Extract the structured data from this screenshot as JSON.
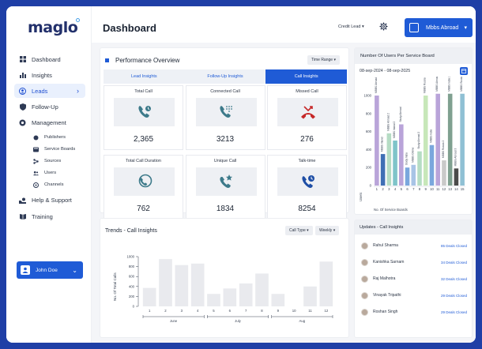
{
  "app": {
    "logo_text": "maglo"
  },
  "sidebar": {
    "items": [
      {
        "label": "Dashboard",
        "icon": "grid-icon"
      },
      {
        "label": "Insights",
        "icon": "bar-chart-icon"
      },
      {
        "label": "Leads",
        "icon": "user-circle-icon",
        "active": true
      },
      {
        "label": "Follow-Up",
        "icon": "shield-icon"
      },
      {
        "label": "Management",
        "icon": "globe-icon"
      }
    ],
    "sub_items": [
      {
        "label": "Publishers",
        "icon": "globe-small-icon"
      },
      {
        "label": "Service Boards",
        "icon": "board-icon"
      },
      {
        "label": "Sources",
        "icon": "source-icon"
      },
      {
        "label": "Users",
        "icon": "users-icon"
      },
      {
        "label": "Channels",
        "icon": "channels-icon"
      }
    ],
    "bottom_items": [
      {
        "label": "Help & Support",
        "icon": "help-icon"
      },
      {
        "label": "Training",
        "icon": "book-icon"
      }
    ],
    "user": {
      "name": "John Doe"
    }
  },
  "header": {
    "title": "Dashboard",
    "credit_label": "Credit Lead",
    "account_button": "Mbbs Abroad"
  },
  "performance": {
    "title": "Performance Overview",
    "time_range_label": "Time Range",
    "tabs": [
      "Lead Insights",
      "Follow-Up Insights",
      "Call Insights"
    ],
    "active_tab": 2,
    "cards": [
      {
        "label": "Total Call",
        "value": "2,365",
        "icon": "phone-clock-icon"
      },
      {
        "label": "Connected Call",
        "value": "3213",
        "icon": "phone-dial-icon"
      },
      {
        "label": "Missed Call",
        "value": "276",
        "icon": "missed-call-icon"
      },
      {
        "label": "Total Call Duration",
        "value": "762",
        "icon": "phone-history-icon"
      },
      {
        "label": "Unique Call",
        "value": "1834",
        "icon": "phone-star-icon"
      },
      {
        "label": "Talk-time",
        "value": "8254",
        "icon": "phone-timer-icon"
      }
    ],
    "colors": {
      "accent": "#1f5bd6",
      "icon_teal": "#3d7a8a",
      "icon_red": "#c62828"
    }
  },
  "users_panel": {
    "title": "Number Of Users Per Service Board",
    "date_range": "08-sep-2024 - 08-sep-2025"
  },
  "trends": {
    "title": "Trends - Call Insights",
    "call_type_label": "Call Type",
    "period_label": "Weekly"
  },
  "updates": {
    "title": "Updates - Call Insights",
    "rows": [
      {
        "name": "Rahul Sharma",
        "count": "85 Deals Closed"
      },
      {
        "name": "Kanishka Sarnam",
        "count": "34 Deals Closed"
      },
      {
        "name": "Raj Malhotra",
        "count": "32 Deals Closed"
      },
      {
        "name": "Vinayak Tripathi",
        "count": "29 Deals Closed"
      },
      {
        "name": "Roshan Singh",
        "count": "29 Deals Closed"
      }
    ]
  },
  "chart_data": [
    {
      "type": "bar",
      "title": "Number Of Users Per Service Board",
      "categories": [
        "1",
        "2",
        "3",
        "4",
        "5",
        "6",
        "7",
        "8",
        "9",
        "10",
        "11",
        "12",
        "13",
        "14",
        "15"
      ],
      "values": [
        1000,
        350,
        580,
        500,
        680,
        200,
        230,
        380,
        1000,
        450,
        1020,
        280,
        1020,
        190,
        1020
      ],
      "bar_colors": [
        "#b9a4d9",
        "#3f6fb5",
        "#b5dcc4",
        "#7fc4c9",
        "#b9a4d9",
        "#7aa7dd",
        "#a8c4e6",
        "#b5dcc4",
        "#c7e7b9",
        "#7aa7dd",
        "#b9a4d9",
        "#c9c9c9",
        "#7fa090",
        "#4b4b4b",
        "#8fc0d4"
      ],
      "bar_labels": [
        "MBBS Abroad",
        "MBBS Inland",
        "MBBS Abroad 2",
        "MBBS Inland 2",
        "Study Abroad",
        "Study India",
        "MBBS Online",
        "Study Abroad 2",
        "MBBS Russia",
        "MBBS India",
        "MBBS Abroad Agent",
        "MBBS Russia 2",
        "MBBS India 2",
        "MBBS Abroad 3",
        "MBBS Russia 3"
      ],
      "ylim": [
        0,
        1000
      ],
      "yticks": [
        "1000",
        "800",
        "600",
        "400",
        "200",
        "0"
      ],
      "ylabel": "Users",
      "xlabel": "No. Of Service Boards"
    },
    {
      "type": "bar",
      "title": "Trends - Call Insights",
      "categories": [
        "1",
        "2",
        "3",
        "4",
        "5",
        "6",
        "7",
        "8",
        "9",
        "10",
        "11",
        "12"
      ],
      "values": [
        370,
        950,
        830,
        860,
        250,
        360,
        460,
        660,
        250,
        0,
        400,
        900
      ],
      "groups": [
        {
          "label": "June",
          "from": 0,
          "to": 4
        },
        {
          "label": "July",
          "from": 4,
          "to": 8
        },
        {
          "label": "Aug",
          "from": 8,
          "to": 12
        }
      ],
      "ylim": [
        0,
        1000
      ],
      "yticks": [
        "1000",
        "800",
        "600",
        "400",
        "200",
        "0"
      ],
      "ylabel": "No. Of Total Calls"
    }
  ]
}
